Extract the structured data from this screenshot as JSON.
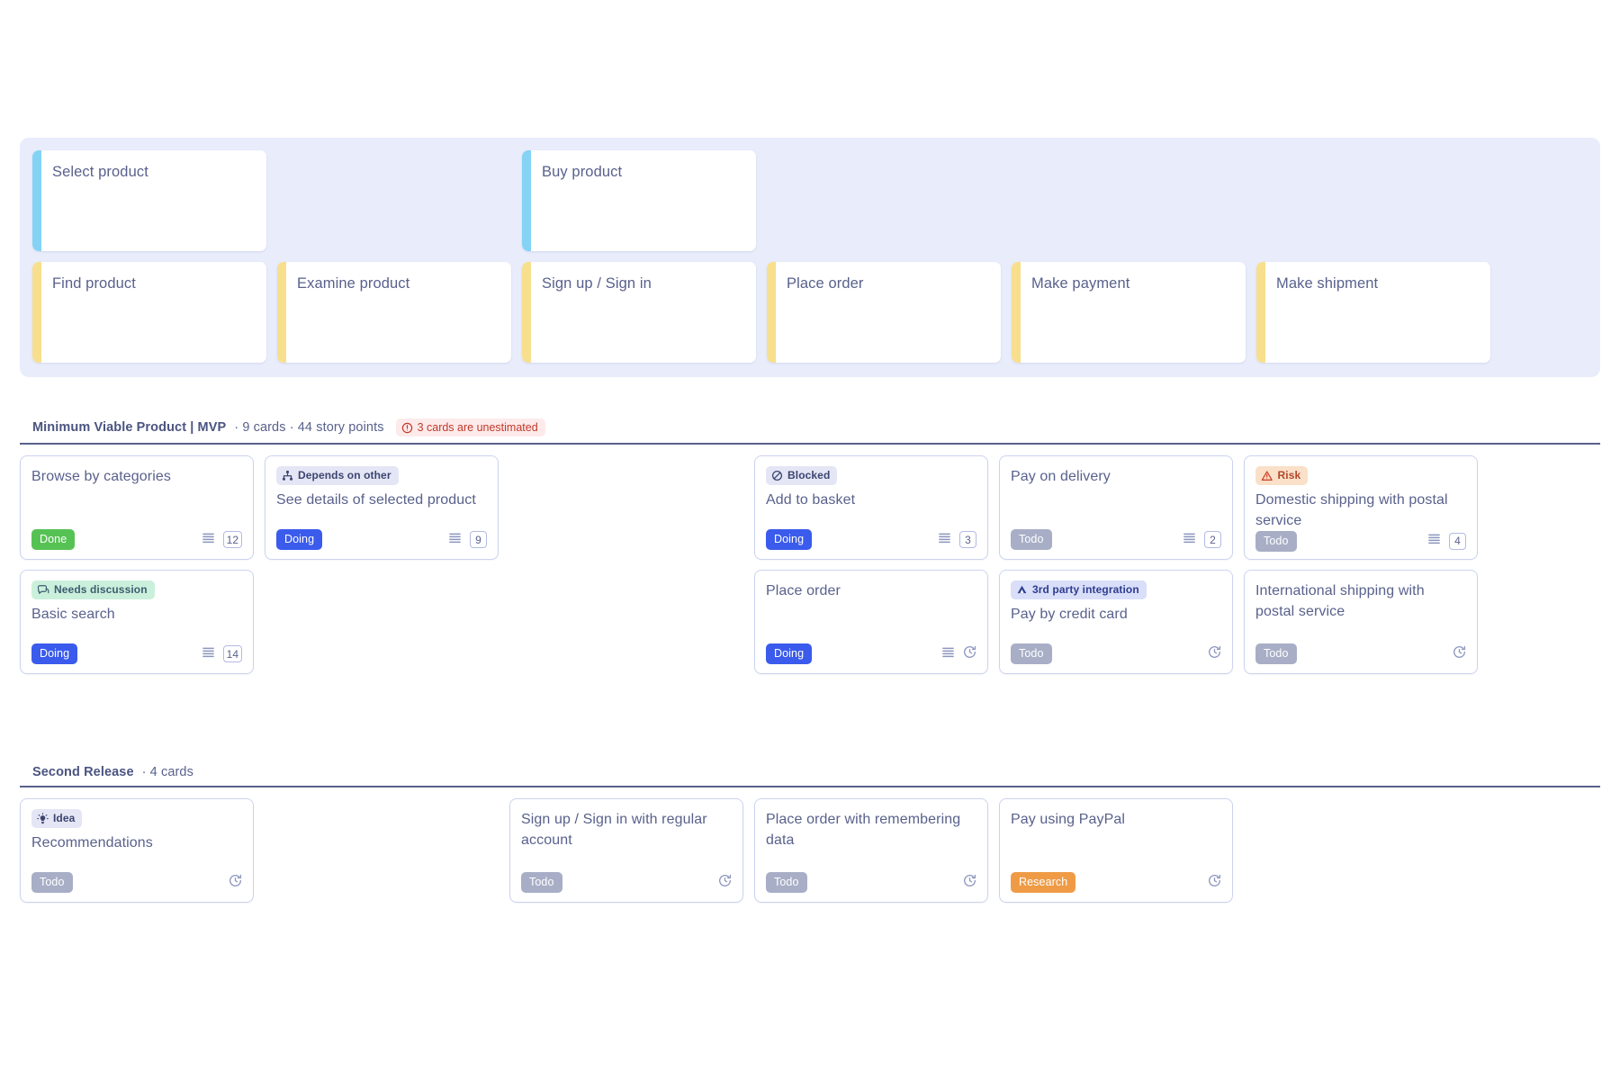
{
  "story_map": {
    "activities": [
      {
        "label": "Select product",
        "column": 0
      },
      {
        "label": "Buy product",
        "column": 2
      }
    ],
    "steps": [
      {
        "label": "Find product"
      },
      {
        "label": "Examine product"
      },
      {
        "label": "Sign up / Sign in"
      },
      {
        "label": "Place order"
      },
      {
        "label": "Make payment"
      },
      {
        "label": "Make shipment"
      }
    ]
  },
  "releases": [
    {
      "name": "Minimum Viable Product",
      "code": "MVP",
      "separator": "|",
      "meta": "· 9 cards · 44 story points",
      "warning": "3 cards are unestimated",
      "warning_icon": "alert-circle-icon",
      "columns": [
        {
          "cards": [
            {
              "title": "Browse by categories",
              "tag": null,
              "status": "Done",
              "status_class": "pill-done",
              "has_description": true,
              "points": "12",
              "unestimated": false
            },
            {
              "title": "Basic search",
              "tag": {
                "label": "Needs discussion",
                "icon": "discussion-icon",
                "style": "tag-green"
              },
              "status": "Doing",
              "status_class": "pill-doing",
              "has_description": true,
              "points": "14",
              "unestimated": false
            }
          ]
        },
        {
          "cards": [
            {
              "title": "See details of selected product",
              "tag": {
                "label": "Depends on other",
                "icon": "dependency-icon",
                "style": "tag-lavender"
              },
              "status": "Doing",
              "status_class": "pill-doing",
              "has_description": true,
              "points": "9",
              "unestimated": false
            }
          ]
        },
        {
          "cards": []
        },
        {
          "cards": [
            {
              "title": "Add to basket",
              "tag": {
                "label": "Blocked",
                "icon": "blocked-icon",
                "style": "tag-lavender"
              },
              "status": "Doing",
              "status_class": "pill-doing",
              "has_description": true,
              "points": "3",
              "unestimated": false
            },
            {
              "title": "Place order",
              "tag": null,
              "status": "Doing",
              "status_class": "pill-doing",
              "has_description": true,
              "points": null,
              "unestimated": true
            }
          ]
        },
        {
          "cards": [
            {
              "title": "Pay on delivery",
              "tag": null,
              "status": "Todo",
              "status_class": "pill-todo",
              "has_description": true,
              "points": "2",
              "unestimated": false
            },
            {
              "title": "Pay by credit card",
              "tag": {
                "label": "3rd party integration",
                "icon": "integration-icon",
                "style": "tag-blue"
              },
              "status": "Todo",
              "status_class": "pill-todo",
              "has_description": false,
              "points": null,
              "unestimated": true
            }
          ]
        },
        {
          "cards": [
            {
              "title": "Domestic shipping with postal service",
              "tag": {
                "label": "Risk",
                "icon": "risk-icon",
                "style": "tag-orange"
              },
              "status": "Todo",
              "status_class": "pill-todo",
              "has_description": true,
              "points": "4",
              "unestimated": false
            },
            {
              "title": "International shipping with postal service",
              "tag": null,
              "status": "Todo",
              "status_class": "pill-todo",
              "has_description": false,
              "points": null,
              "unestimated": true
            }
          ]
        }
      ]
    },
    {
      "name": "Second Release",
      "code": null,
      "separator": "",
      "meta": "· 4 cards",
      "warning": null,
      "warning_icon": null,
      "columns": [
        {
          "cards": [
            {
              "title": "Recommendations",
              "tag": {
                "label": "Idea",
                "icon": "idea-icon",
                "style": "tag-lavender"
              },
              "status": "Todo",
              "status_class": "pill-todo",
              "has_description": false,
              "points": null,
              "unestimated": true
            }
          ]
        },
        {
          "cards": []
        },
        {
          "cards": [
            {
              "title": "Sign up / Sign in with regular account",
              "tag": null,
              "status": "Todo",
              "status_class": "pill-todo",
              "has_description": false,
              "points": null,
              "unestimated": true
            }
          ]
        },
        {
          "cards": [
            {
              "title": "Place order with remembering data",
              "tag": null,
              "status": "Todo",
              "status_class": "pill-todo",
              "has_description": false,
              "points": null,
              "unestimated": true
            }
          ]
        },
        {
          "cards": [
            {
              "title": "Pay using PayPal",
              "tag": null,
              "status": "Research",
              "status_class": "pill-research",
              "has_description": false,
              "points": null,
              "unestimated": true
            }
          ]
        },
        {
          "cards": []
        }
      ]
    }
  ],
  "colors": {
    "activity_accent": "#84d3f5",
    "step_accent": "#f7df8e",
    "map_background": "#e8ecfb",
    "text": "#59618c",
    "done": "#56c254",
    "doing": "#3a5bec",
    "todo": "#a8aec6",
    "research": "#ef9b46",
    "warning": "#c0392b"
  }
}
